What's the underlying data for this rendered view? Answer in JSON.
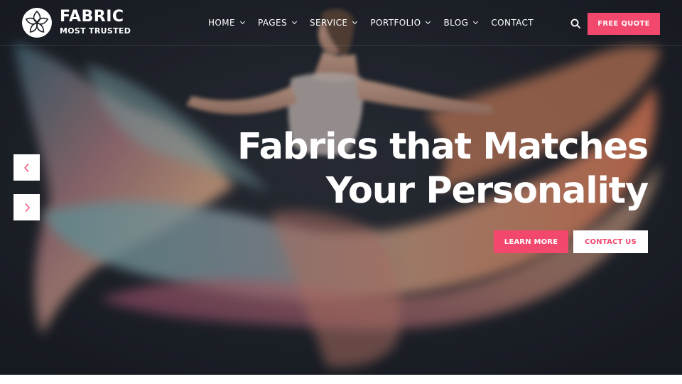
{
  "brand": {
    "name": "FABRIC",
    "tagline": "MOST TRUSTED",
    "logo_icon": "flower-swirl-logo-icon"
  },
  "nav": {
    "items": [
      {
        "label": "HOME",
        "has_dropdown": true
      },
      {
        "label": "PAGES",
        "has_dropdown": true
      },
      {
        "label": "SERVICE",
        "has_dropdown": true
      },
      {
        "label": "PORTFOLIO",
        "has_dropdown": true
      },
      {
        "label": "BLOG",
        "has_dropdown": true
      },
      {
        "label": "CONTACT",
        "has_dropdown": false
      }
    ]
  },
  "header": {
    "search_icon": "search-icon",
    "quote_label": "FREE QUOTE"
  },
  "hero": {
    "headline_line1": "Fabrics that Matches",
    "headline_line2": "Your Personality",
    "primary_cta": "LEARN MORE",
    "secondary_cta": "CONTACT US",
    "prev_icon": "chevron-left-icon",
    "next_icon": "chevron-right-icon"
  },
  "colors": {
    "accent": "#f2486e",
    "hero_background": "#1d2028",
    "text_light": "#ffffff"
  }
}
